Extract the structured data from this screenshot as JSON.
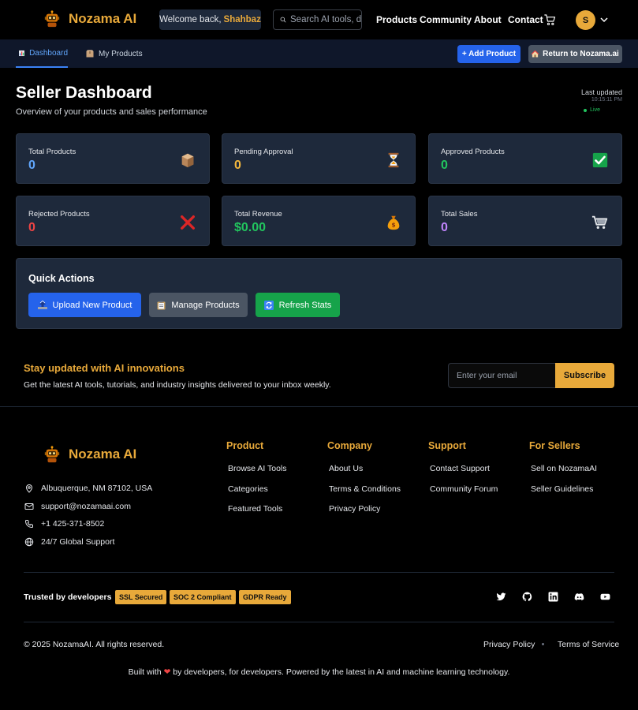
{
  "brand": {
    "name": "Nozama AI"
  },
  "header": {
    "welcome_prefix": "Welcome back,",
    "welcome_user": "Shahbaz",
    "search_placeholder": "Search AI tools, data",
    "nav": [
      "Products",
      "Community",
      "About",
      "Contact"
    ],
    "avatar_initial": "S"
  },
  "subnav": {
    "tabs": [
      {
        "label": "Dashboard",
        "active": true
      },
      {
        "label": "My Products",
        "active": false
      }
    ],
    "add_product": "+ Add Product",
    "return": "Return to Nozama.ai"
  },
  "page": {
    "title": "Seller Dashboard",
    "subtitle": "Overview of your products and sales performance",
    "last_updated_label": "Last updated",
    "last_updated_time": "10:15:11 PM",
    "live": "Live"
  },
  "stats": [
    {
      "label": "Total Products",
      "value": "0",
      "color": "#60a5fa",
      "icon": "box-icon"
    },
    {
      "label": "Pending Approval",
      "value": "0",
      "color": "#f5b83d",
      "icon": "hourglass-icon"
    },
    {
      "label": "Approved Products",
      "value": "0",
      "color": "#22c55e",
      "icon": "check-icon"
    },
    {
      "label": "Rejected Products",
      "value": "0",
      "color": "#ef4444",
      "icon": "cross-icon"
    },
    {
      "label": "Total Revenue",
      "value": "$0.00",
      "color": "#22c55e",
      "icon": "money-bag-icon"
    },
    {
      "label": "Total Sales",
      "value": "0",
      "color": "#c084fc",
      "icon": "cart-icon"
    }
  ],
  "quick_actions": {
    "title": "Quick Actions",
    "buttons": [
      {
        "label": "Upload New Product",
        "color": "#2563eb"
      },
      {
        "label": "Manage Products",
        "color": "#4b5563"
      },
      {
        "label": "Refresh Stats",
        "color": "#16a34a"
      }
    ]
  },
  "newsletter": {
    "title": "Stay updated with AI innovations",
    "subtitle": "Get the latest AI tools, tutorials, and industry insights delivered to your inbox weekly.",
    "placeholder": "Enter your email",
    "button": "Subscribe"
  },
  "footer": {
    "contact": [
      "Albuquerque, NM 87102, USA",
      "support@nozamaai.com",
      "+1 425-371-8502",
      "24/7 Global Support"
    ],
    "columns": [
      {
        "title": "Product",
        "links": [
          "Browse AI Tools",
          "Categories",
          "Featured Tools"
        ]
      },
      {
        "title": "Company",
        "links": [
          "About Us",
          "Terms & Conditions",
          "Privacy Policy"
        ]
      },
      {
        "title": "Support",
        "links": [
          "Contact Support",
          "Community Forum"
        ]
      },
      {
        "title": "For Sellers",
        "links": [
          "Sell on NozamaAI",
          "Seller Guidelines"
        ]
      }
    ],
    "trusted_label": "Trusted by developers",
    "badges": [
      "SSL Secured",
      "SOC 2 Compliant",
      "GDPR Ready"
    ],
    "copyright": "© 2025 NozamaAI. All rights reserved.",
    "legal": [
      "Privacy Policy",
      "Terms of Service"
    ],
    "built_prefix": "Built with",
    "built_suffix": "by developers, for developers. Powered by the latest in AI and machine learning technology."
  },
  "colors": {
    "accent": "#e8a93a",
    "primary": "#2563eb",
    "card_bg": "#1e293b"
  }
}
